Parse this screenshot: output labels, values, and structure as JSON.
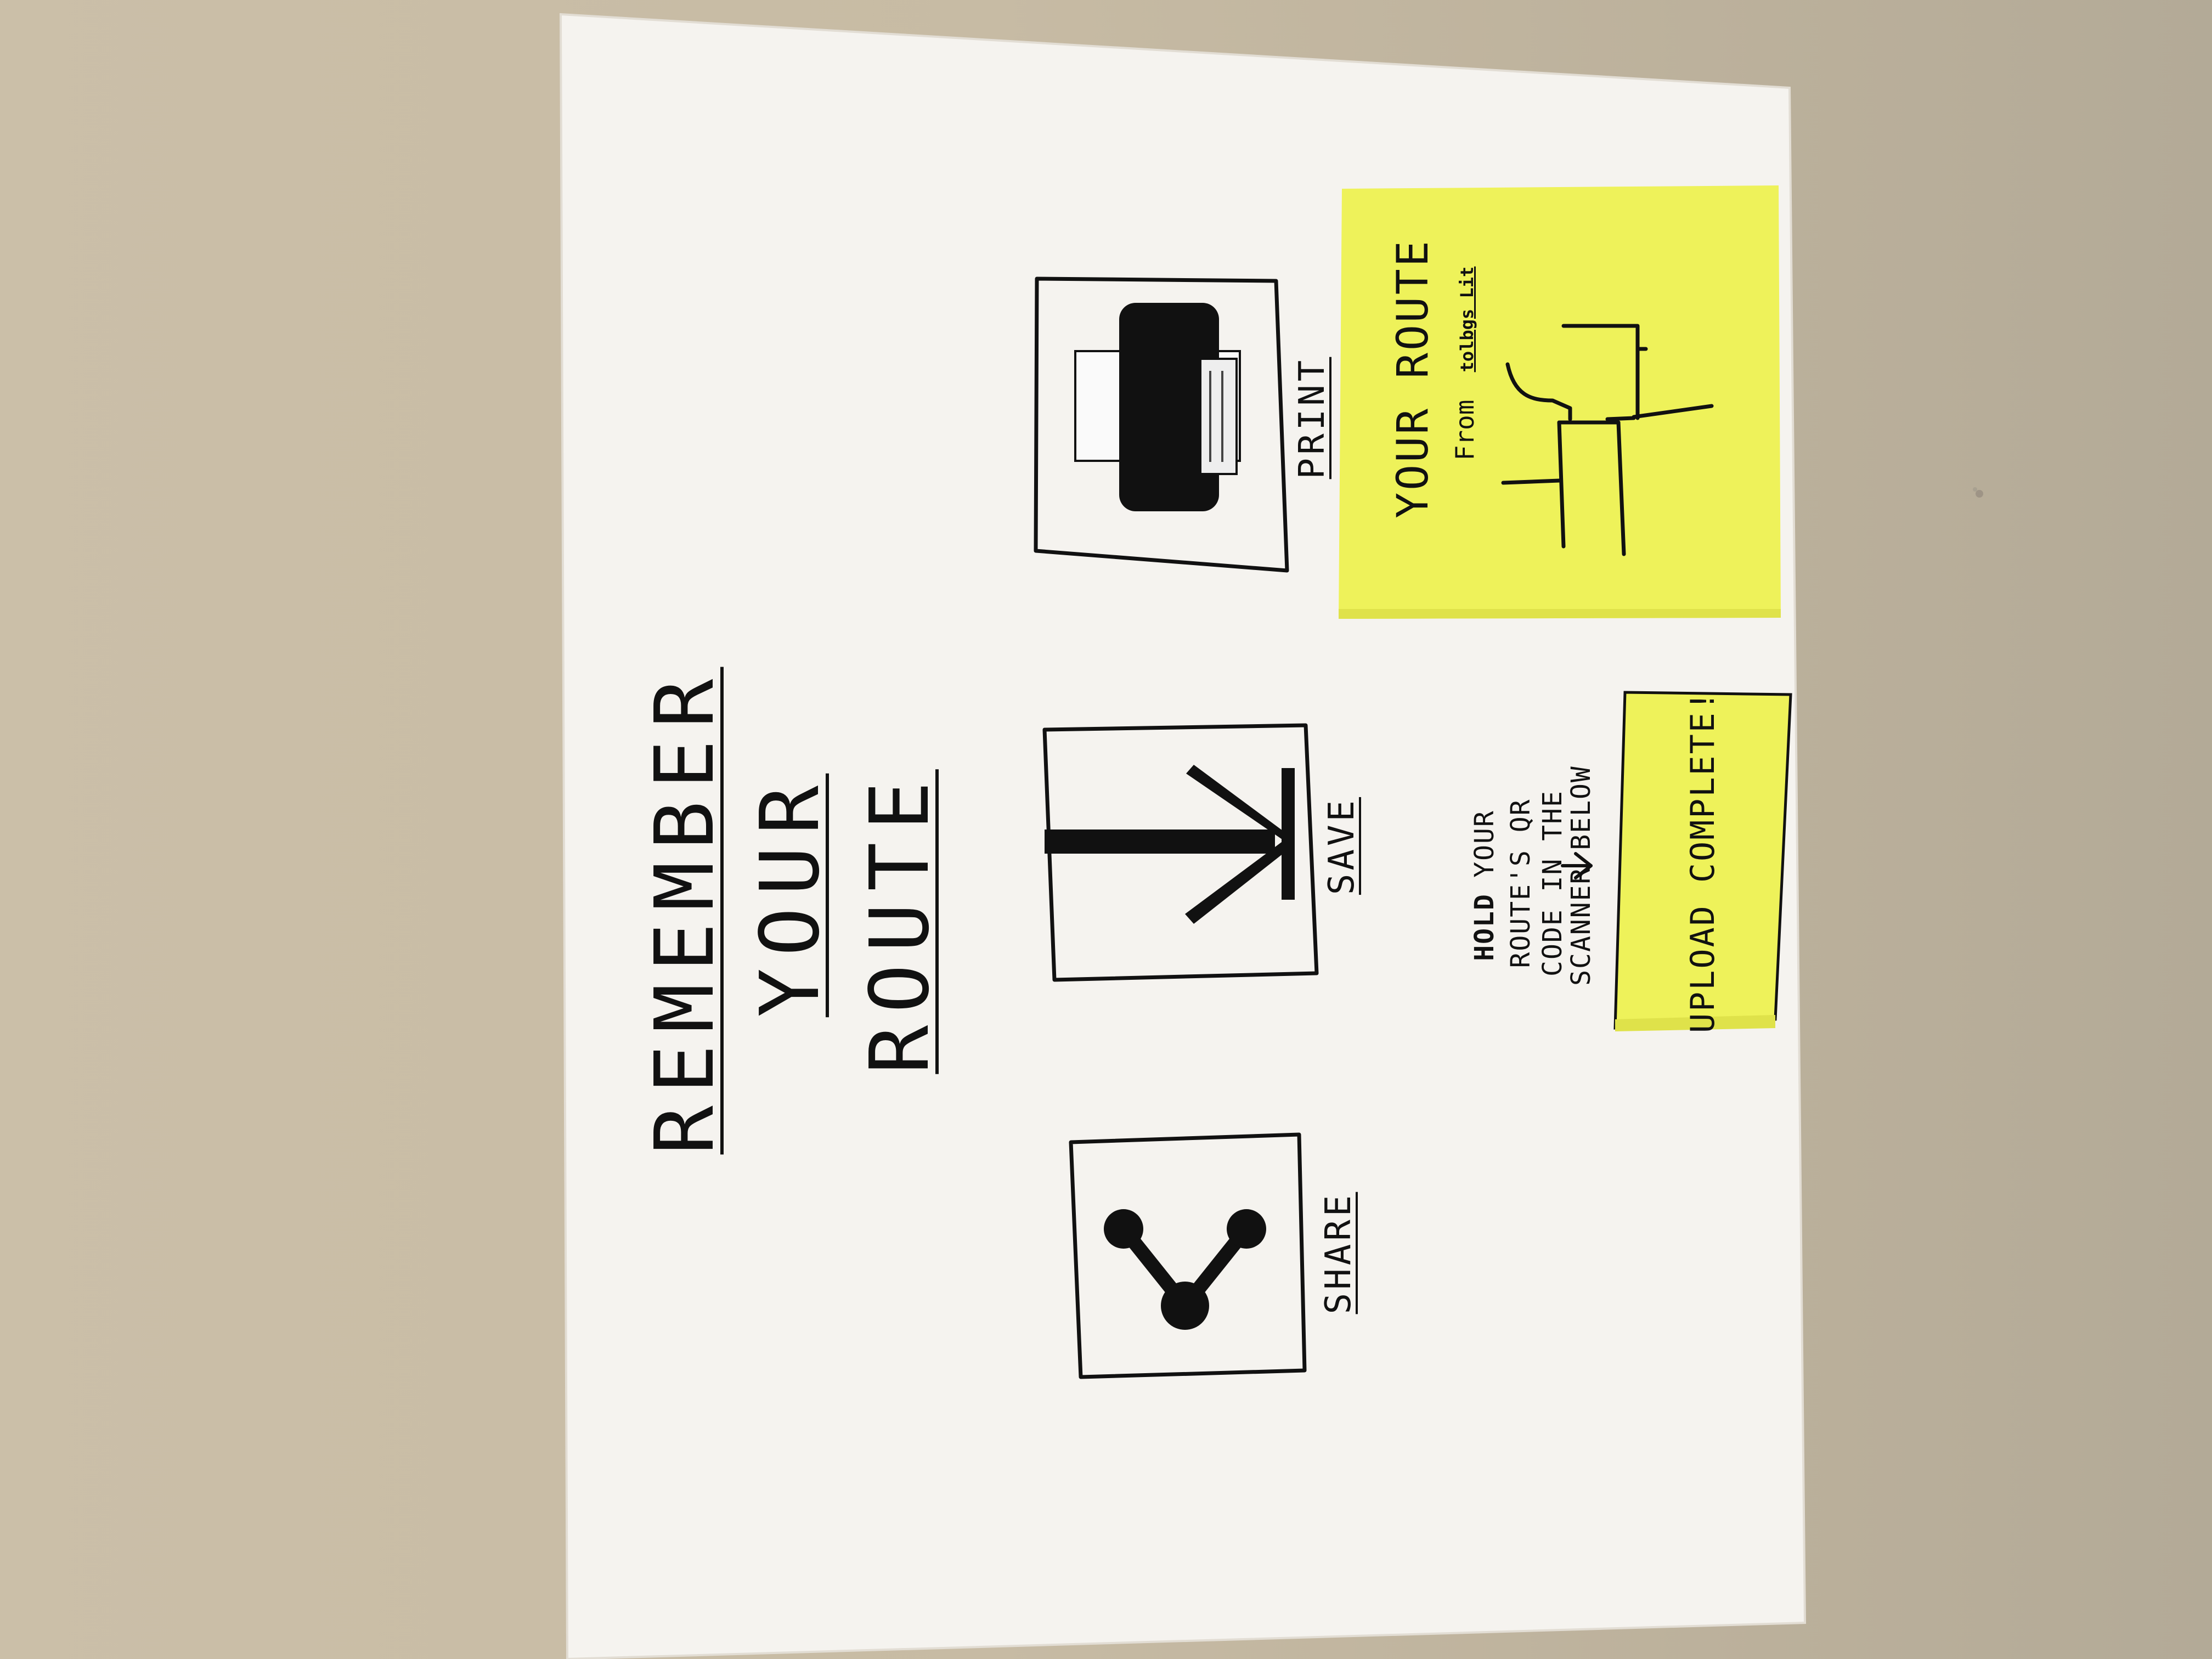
{
  "poster": {
    "title_lines": [
      "REMEMBER",
      "YOUR",
      "ROUTE"
    ]
  },
  "actions": {
    "share_label": "SHARE",
    "save_label": "SAVE",
    "print_label": "PRINT"
  },
  "instruction": {
    "bold_word": "HOLD",
    "line1_rest": "YOUR",
    "line2": "ROUTE'S QR",
    "line3": "CODE IN THE",
    "line4": "SCANNER BELOW"
  },
  "route_note": {
    "title": "YOUR ROUTE",
    "from_label": "From",
    "from_value": "tolbgs Lit"
  },
  "upload_note": {
    "text": "UPLOAD COMPLETE!"
  },
  "colors": {
    "wall": "#c7bba4",
    "paper": "#f4f2ee",
    "ink": "#111111",
    "sticky": "#eef25a"
  },
  "icons": [
    "share-icon",
    "download-arrow-icon",
    "printer-icon",
    "arrow-down-icon"
  ]
}
